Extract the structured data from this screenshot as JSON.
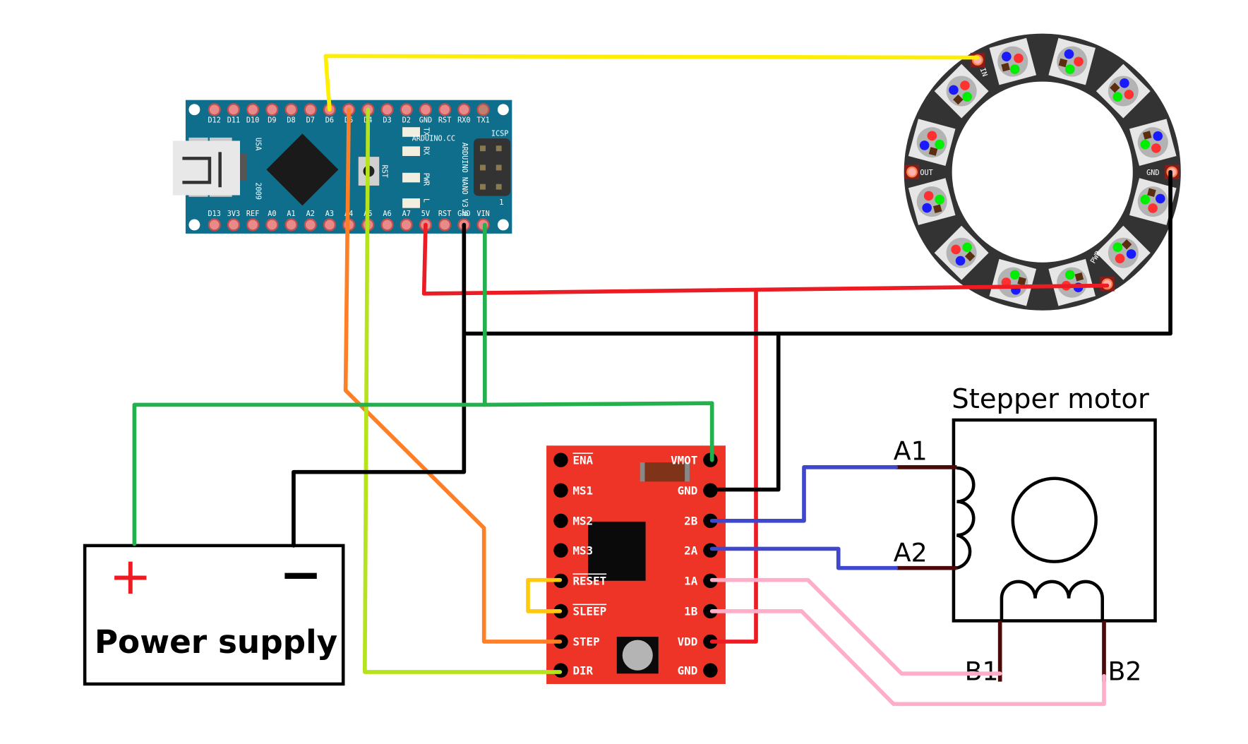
{
  "colors": {
    "arduino_board": "#0f6e8c",
    "driver_board": "#ee3427",
    "ring": "#333333",
    "wire_yellow": "#ffee00",
    "wire_orange": "#ff7f27",
    "wire_lime": "#b5e31c",
    "wire_red": "#ed1c24",
    "wire_black": "#000000",
    "wire_green": "#22b14c",
    "wire_blue": "#3f48cc",
    "wire_pink": "#ffaec9",
    "lead_darkred": "#4a0a0a"
  },
  "arduino": {
    "top_pins": [
      "D12",
      "D11",
      "D10",
      "D9",
      "D8",
      "D7",
      "D6",
      "D5",
      "D4",
      "D3",
      "D2",
      "GND",
      "RST",
      "RX0",
      "TX1"
    ],
    "bottom_pins": [
      "D13",
      "3V3",
      "REF",
      "A0",
      "A1",
      "A2",
      "A3",
      "A4",
      "A5",
      "A6",
      "A7",
      "5V",
      "RST",
      "GND",
      "VIN"
    ],
    "brand": "ARDUINO.CC",
    "model": "ARDUINO NANO V3.0",
    "usa": "USA",
    "year": "2009",
    "rst": "RST",
    "leds": [
      "TX",
      "RX",
      "PWR",
      "L"
    ],
    "icsp": "ICSP",
    "icsp_num": "1"
  },
  "ring": {
    "pads": {
      "in": "IN",
      "out": "OUT",
      "gnd": "GND",
      "pwr": "PWR"
    },
    "led_count": 12
  },
  "driver": {
    "left_pins": [
      "ENA",
      "MS1",
      "MS2",
      "MS3",
      "RESET",
      "SLEEP",
      "STEP",
      "DIR"
    ],
    "right_pins": [
      "VMOT",
      "GND",
      "2B",
      "2A",
      "1A",
      "1B",
      "VDD",
      "GND"
    ]
  },
  "power_supply": {
    "label": "Power supply",
    "plus": "+",
    "minus": "−"
  },
  "motor": {
    "title": "Stepper motor",
    "leads": [
      "A1",
      "A2",
      "B1",
      "B2"
    ]
  }
}
